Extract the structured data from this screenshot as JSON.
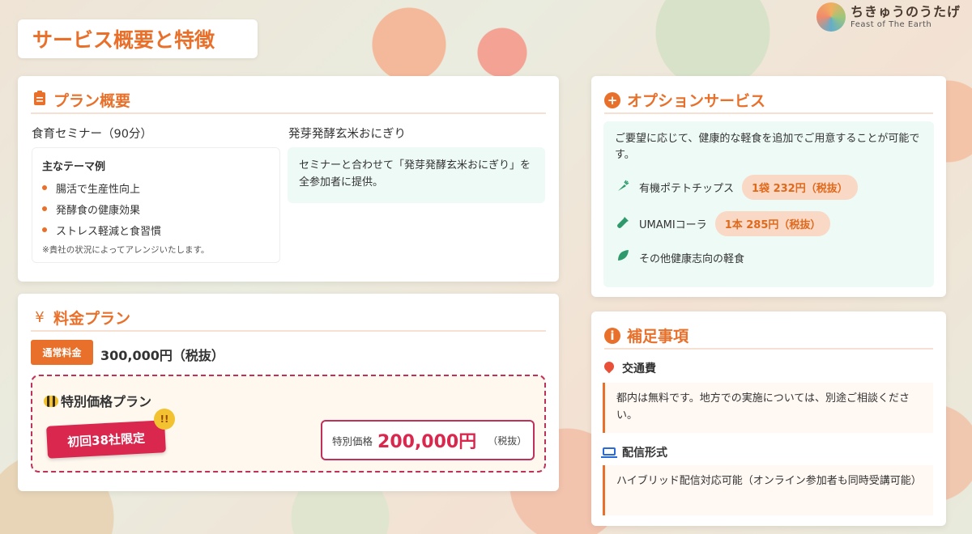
{
  "page_title": "サービス概要と特徴",
  "logo": {
    "jp": "ちきゅうのうたげ",
    "en": "Feast of The Earth"
  },
  "plan": {
    "heading": "プラン概要",
    "seminar_title": "食育セミナー（90分）",
    "themes_heading": "主なテーマ例",
    "themes": [
      "腸活で生産性向上",
      "発酵食の健康効果",
      "ストレス軽減と食習慣"
    ],
    "note": "※貴社の状況によってアレンジいたします。",
    "onigiri_title": "発芽発酵玄米おにぎり",
    "onigiri_text": "セミナーと合わせて「発芽発酵玄米おにぎり」を全参加者に提供。"
  },
  "pricing": {
    "heading": "料金プラン",
    "heading_icon": "¥",
    "normal_tag": "通常料金",
    "normal_price": "300,000円（税抜）",
    "special_title": "特別価格プラン",
    "limited_label": "初回38社限定",
    "badge": "!!",
    "special_price_label": "特別価格",
    "special_price": "200,000円",
    "special_price_tax": "（税抜）"
  },
  "options": {
    "heading": "オプションサービス",
    "description": "ご要望に応じて、健康的な軽食を追加でご用意することが可能です。",
    "items": [
      {
        "icon": "carrot-icon",
        "name": "有機ポテトチップス",
        "price": "1袋 232円（税抜）"
      },
      {
        "icon": "bottle-icon",
        "name": "UMAMIコーラ",
        "price": "1本 285円（税抜）"
      },
      {
        "icon": "leaf-icon",
        "name": "その他健康志向の軽食"
      }
    ]
  },
  "notes": {
    "heading": "補足事項",
    "transport_title": "交通費",
    "transport_text": "都内は無料です。地方での実施については、別途ご相談ください。",
    "delivery_title": "配信形式",
    "delivery_text": "ハイブリッド配信対応可能（オンライン参加者も同時受講可能）"
  },
  "colors": {
    "accent": "#e8702a",
    "special": "#d9274e",
    "option_green": "#2e9a6c"
  }
}
